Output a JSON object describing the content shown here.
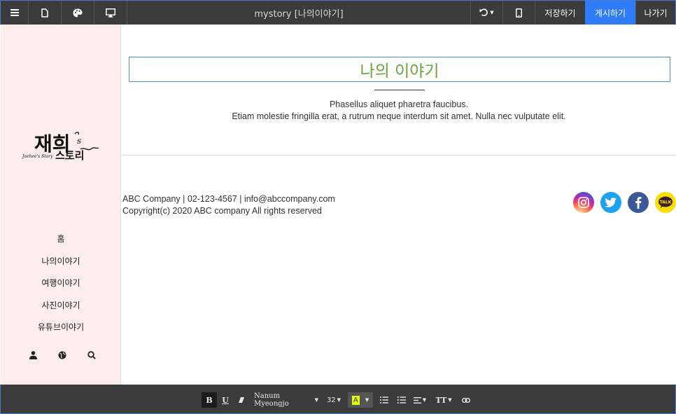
{
  "topbar": {
    "title": "mystory [나의이야기]",
    "save_label": "저장하기",
    "publish_label": "게시하기",
    "exit_label": "나가기",
    "icons": [
      "menu-icon",
      "page-icon",
      "palette-icon",
      "monitor-icon",
      "undo-icon",
      "mobile-icon"
    ],
    "accent_color": "#2f7df6"
  },
  "sidebar": {
    "logo": {
      "main_text": "재희",
      "suffix": "s",
      "story_text": "스토리",
      "script_text": "Jaehee's Story"
    },
    "nav": [
      {
        "label": "홈"
      },
      {
        "label": "나의이야기"
      },
      {
        "label": "여행이야기"
      },
      {
        "label": "사진이야기"
      },
      {
        "label": "유튜브이야기"
      }
    ],
    "icons": [
      "user-icon",
      "globe-icon",
      "search-icon"
    ],
    "bg_color": "#fdeeed"
  },
  "main": {
    "title": "나의 이야기",
    "title_color": "#6ca33b",
    "line1": "Phasellus aliquet pharetra faucibus.",
    "line2": "Etiam molestie fringilla erat, a rutrum neque interdum sit amet. Nulla nec vulputate elit.",
    "footer": {
      "contact": "ABC Company | 02-123-4567 | info@abccompany.com",
      "copyright": "Copyright(c) 2020 ABC company All rights reserved",
      "social": [
        "instagram-icon",
        "twitter-icon",
        "facebook-icon",
        "kakaotalk-icon"
      ],
      "kakao_label": "TALK"
    }
  },
  "editor_toolbar": {
    "bold": "B",
    "underline": "U",
    "font_family": "Nanum Myeongjo",
    "font_size": "32",
    "color_label": "A",
    "text_color": "#e6ff00",
    "text_style": "TT"
  }
}
